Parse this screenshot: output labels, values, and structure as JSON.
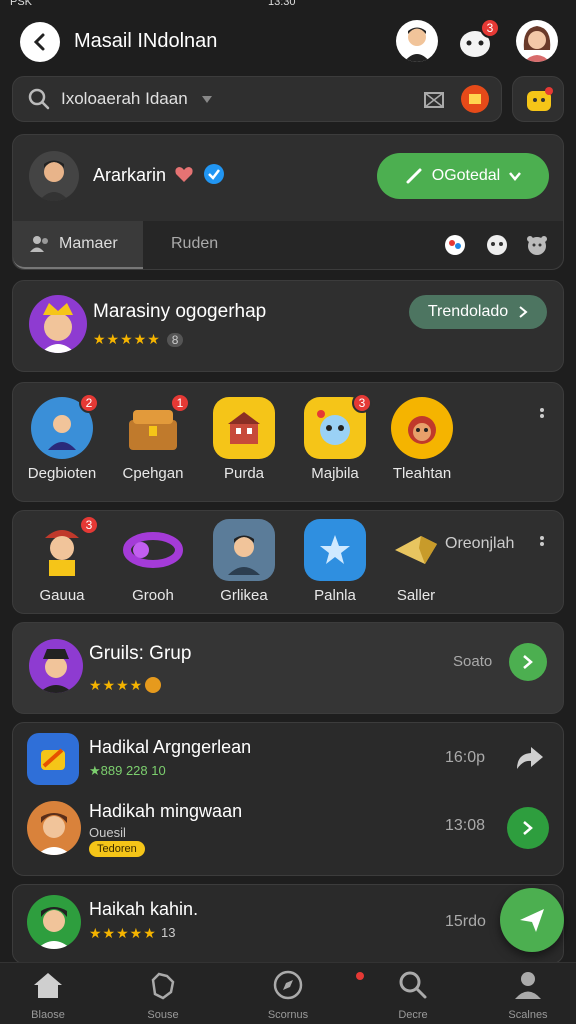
{
  "status_bar": {
    "left": "PSK",
    "center": "13:30"
  },
  "header": {
    "title": "Masail INdolnan",
    "notifications_count": "3"
  },
  "search": {
    "value": "Ixoloaerah Idaan",
    "quick_badge": ""
  },
  "profile": {
    "name": "Ararkarin",
    "action_label": "OGotedal",
    "tabs": [
      {
        "label": "Mamaer"
      },
      {
        "label": "Ruden"
      }
    ]
  },
  "featured": {
    "title": "Marasiny ogogerhap",
    "rating_count": "8",
    "button_label": "Trendolado"
  },
  "apps_row1": [
    {
      "label": "Degbioten",
      "badge": "2"
    },
    {
      "label": "Cpehgan",
      "badge": "1"
    },
    {
      "label": "Purda",
      "badge": ""
    },
    {
      "label": "Majbila",
      "badge": "3"
    },
    {
      "label": "Tleahtan",
      "badge": ""
    }
  ],
  "apps_row2": [
    {
      "label": "Gauua",
      "badge": "3"
    },
    {
      "label": "Grooh",
      "badge": ""
    },
    {
      "label": "Grlikea",
      "badge": ""
    },
    {
      "label": "Palnla",
      "badge": ""
    },
    {
      "label": "Saller",
      "badge": ""
    }
  ],
  "apps_row2_extra": "Oreonjlah",
  "group": {
    "title": "Gruils: Grup",
    "meta": "Soato"
  },
  "list": [
    {
      "title": "Hadikal Argngerlean",
      "sub": "★889 228 10",
      "time": "16:0p"
    },
    {
      "title": "Hadikah mingwaan",
      "sub": "Ouesil",
      "chip": "Tedoren",
      "time": "13:08"
    },
    {
      "title": "Haikah kahin.",
      "rating": "13",
      "time": "15rdo"
    }
  ],
  "bottom_nav": [
    {
      "label": "Blaose"
    },
    {
      "label": "Souse"
    },
    {
      "label": "Scornus"
    },
    {
      "label": "Decre"
    },
    {
      "label": "Scalnes"
    }
  ],
  "colors": {
    "accent_green": "#4caf50",
    "bg": "#1e1e1e",
    "card": "#2f2f2f",
    "badge_red": "#e53935"
  }
}
